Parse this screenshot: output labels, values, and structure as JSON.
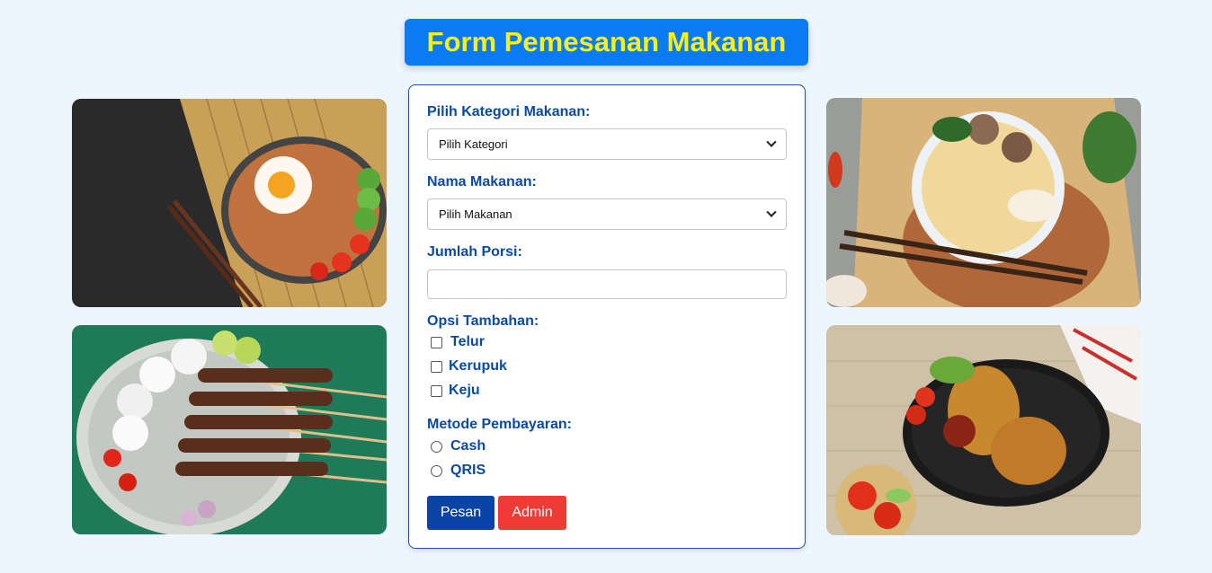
{
  "header": {
    "title": "Form Pemesanan Makanan"
  },
  "form": {
    "category": {
      "label": "Pilih Kategori Makanan:",
      "selected": "Pilih Kategori"
    },
    "food": {
      "label": "Nama Makanan:",
      "selected": "Pilih Makanan"
    },
    "portion": {
      "label": "Jumlah Porsi:",
      "value": ""
    },
    "extras": {
      "label": "Opsi Tambahan:",
      "options": [
        "Telur",
        "Kerupuk",
        "Keju"
      ]
    },
    "payment": {
      "label": "Metode Pembayaran:",
      "options": [
        "Cash",
        "QRIS"
      ]
    },
    "buttons": {
      "submit": "Pesan",
      "admin": "Admin"
    }
  },
  "images": [
    "fried-rice-photo",
    "satay-photo",
    "chicken-noodle-photo",
    "fried-chicken-photo"
  ],
  "colors": {
    "title_bg": "#0a7bf2",
    "title_text": "#f7f01c",
    "label": "#0b4aa2",
    "submit": "#0b44a4",
    "admin": "#ef3b35",
    "page_bg": "#eef6fd"
  }
}
